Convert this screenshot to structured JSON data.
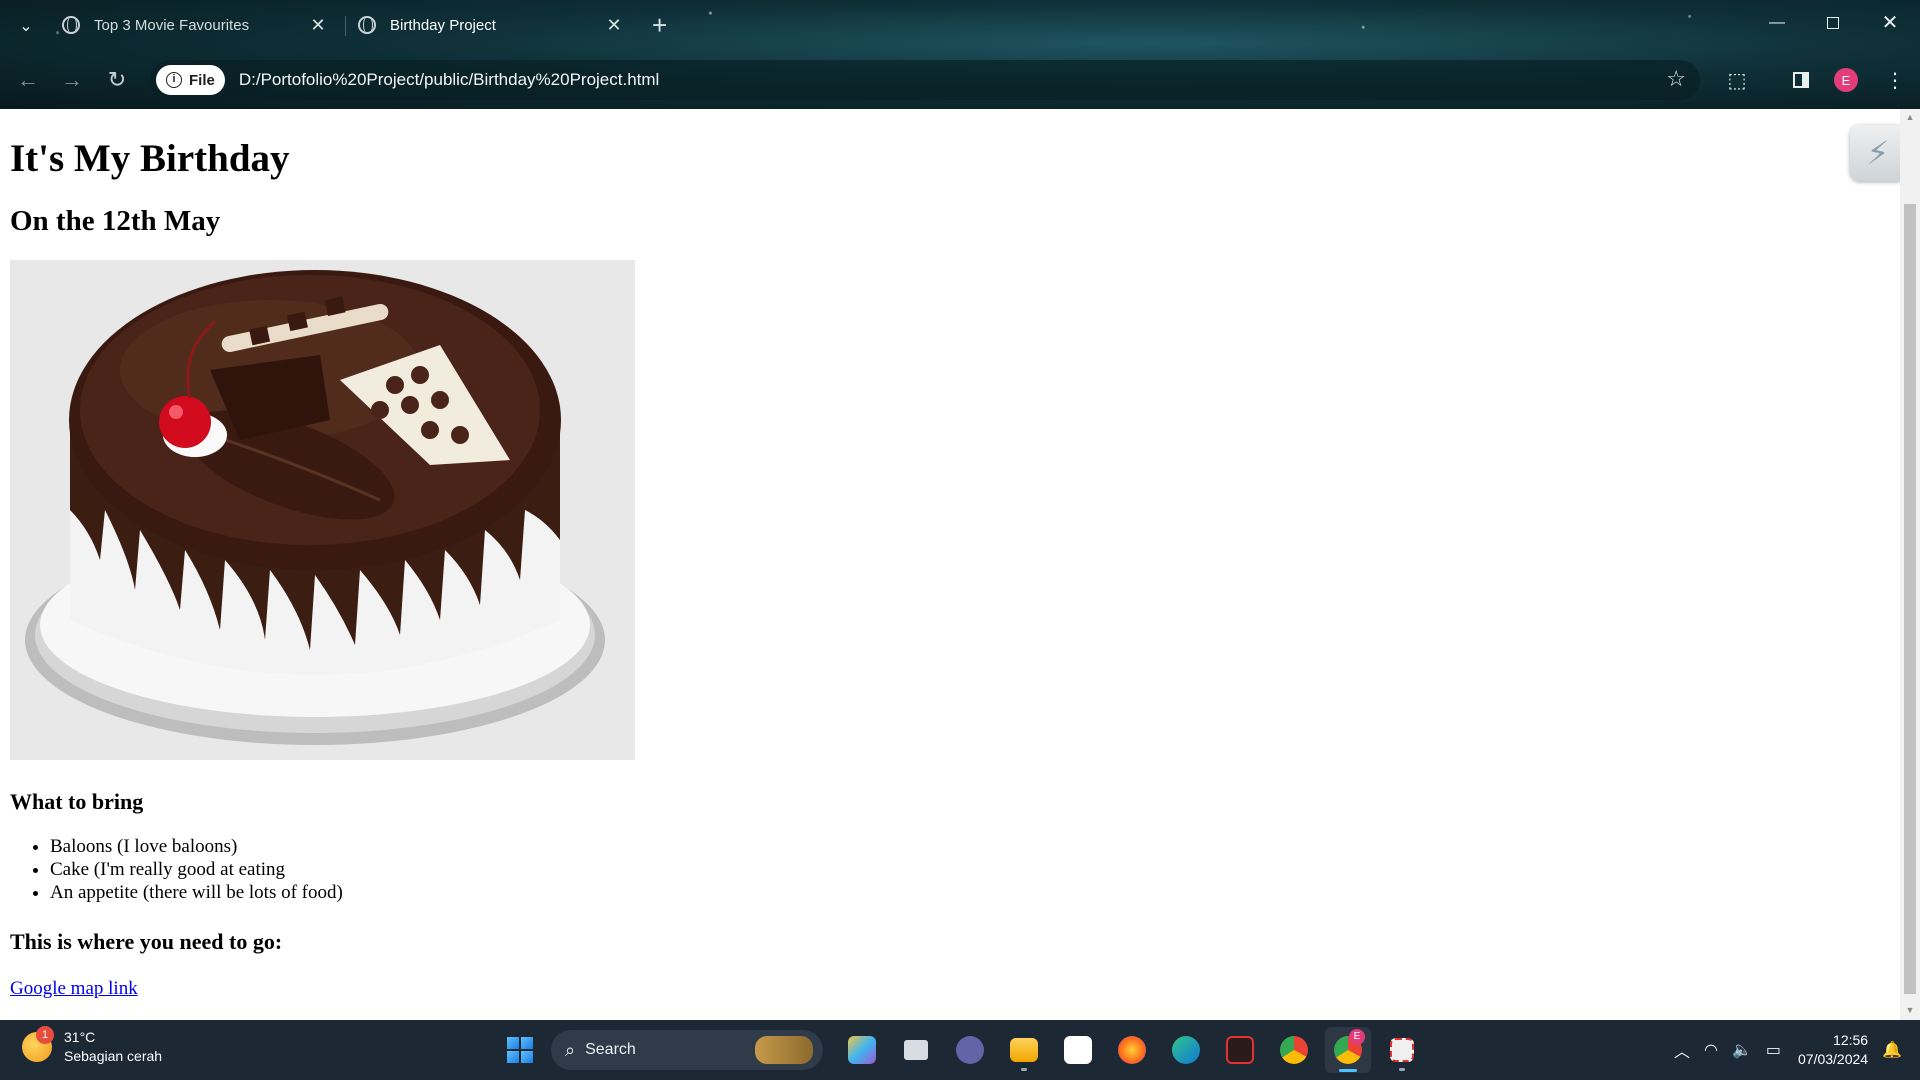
{
  "browser": {
    "tabs": [
      {
        "title": "Top 3 Movie Favourites",
        "active": false
      },
      {
        "title": "Birthday Project",
        "active": true
      }
    ],
    "new_tab": "+",
    "close_glyph": "✕",
    "site_chip": "File",
    "url": "D:/Portofolio%20Project/public/Birthday%20Project.html",
    "avatar_letter": "E"
  },
  "page": {
    "heading": "It's My Birthday",
    "date": "On the 12th May",
    "what_to_bring_heading": "What to bring",
    "bring_items": [
      "Baloons (I love baloons)",
      "Cake (I'm really good at eating",
      "An appetite (there will be lots of food)"
    ],
    "where_heading": "This is where you need to go:",
    "map_link": "Google map link"
  },
  "taskbar": {
    "weather_temp": "31°C",
    "weather_desc": "Sebagian cerah",
    "weather_badge": "1",
    "search_label": "Search",
    "time": "12:56",
    "date": "07/03/2024",
    "chrome_badge": "E",
    "apps": [
      "copilot-icon",
      "task-view-icon",
      "meet-icon",
      "file-explorer-icon",
      "store-icon",
      "firefox-icon",
      "edge-icon",
      "recorder-icon",
      "chrome-icon",
      "chrome-profile-icon",
      "snipping-tool-icon"
    ]
  },
  "colors": {
    "link": "#0000ee",
    "chrome_bg": "#0f3038",
    "taskbar_bg": "#1d2835",
    "avatar": "#e23c7a"
  }
}
